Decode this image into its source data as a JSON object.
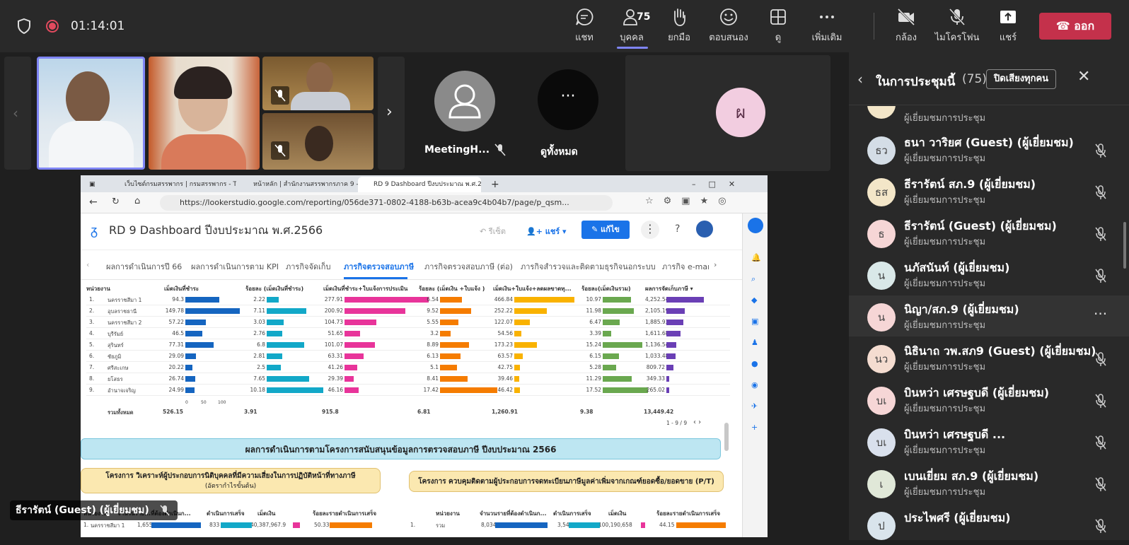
{
  "meeting": {
    "timer": "01:14:01",
    "toolbar": [
      {
        "label": "แชท",
        "icon": "chat-icon"
      },
      {
        "label": "บุคคล",
        "icon": "people-icon",
        "count": "75"
      },
      {
        "label": "ยกมือ",
        "icon": "raise-hand-icon"
      },
      {
        "label": "ตอบสนอง",
        "icon": "react-icon"
      },
      {
        "label": "ดู",
        "icon": "view-icon"
      },
      {
        "label": "เพิ่มเติม",
        "icon": "more-icon"
      },
      {
        "label": "กล้อง",
        "icon": "camera-off-icon"
      },
      {
        "label": "ไมโครโฟน",
        "icon": "mic-off-icon"
      },
      {
        "label": "แชร์",
        "icon": "share-icon"
      }
    ],
    "leave_label": "ออก"
  },
  "stage": {
    "tile_meetingh": "MeetingH...",
    "tile_view_all": "ดูทั้งหมด",
    "tile_initial": "ผ",
    "speaker_caption": "ธีรารัตน์ (Guest) (ผู้เยี่ยมชม)"
  },
  "browser": {
    "tabs": [
      "เว็บไซต์กรมสรรพากร | กรมสรรพากร - Th",
      "หน้าหลัก | สำนักงานสรรพากรภาค 9 -",
      "RD 9 Dashboard ปีงบประมาณ พ.ศ.2"
    ],
    "url": "https://lookerstudio.google.com/reporting/056de371-0802-4188-b63b-acea9c4b04b7/page/p_qsm...",
    "report_title": "RD 9 Dashboard ปีงบประมาณ พ.ศ.2566",
    "reset_label": "รีเซ็ต",
    "share_label": "แชร์",
    "edit_label": "แก้ไข",
    "nav_tabs": [
      "ผลการดำเนินการปี 66",
      "ผลการดำเนินการตาม KPI",
      "ภารกิจจัดเก็บ",
      "ภารกิจตรวจสอบภาษี",
      "ภารกิจตรวจสอบภาษี (ต่อ)",
      "ภารกิจสำรวจและติดตามธุรกิจนอกระบบ",
      "ภารกิจ e-mar"
    ],
    "table": {
      "headers": [
        "หน่วยงาน",
        "เม็ดเงินที่ชำระ",
        "ร้อยละ (เม็ดเงินที่ชำระ)",
        "เม็ดเงินที่ชำระ+ใบแจ้งการประเมิน",
        "ร้อยละ (เม็ดเงิน +ใบแจ้ง )",
        "เม็ดเงิน+ใบแจ้ง+ลดผลขาดทุ...",
        "ร้อยละ(เม็ดเงินรวม)",
        "ผลการจัดเก็บภาษี ▾"
      ],
      "rows": [
        {
          "no": "1.",
          "unit": "นครราชสีมา 1",
          "v": [
            "94.3",
            "2.22",
            "277.91",
            "6.54",
            "466.84",
            "10.97",
            "4,252.54"
          ]
        },
        {
          "no": "2.",
          "unit": "อุบลราชธานี",
          "v": [
            "149.78",
            "7.11",
            "200.92",
            "9.52",
            "252.22",
            "11.98",
            "2,105.19"
          ]
        },
        {
          "no": "3.",
          "unit": "นครราชสีมา 2",
          "v": [
            "57.22",
            "3.03",
            "104.73",
            "5.55",
            "122.07",
            "6.47",
            "1,885.93"
          ]
        },
        {
          "no": "4.",
          "unit": "บุรีรัมย์",
          "v": [
            "46.5",
            "2.76",
            "51.65",
            "3.2",
            "54.56",
            "3.39",
            "1,611.68"
          ]
        },
        {
          "no": "5.",
          "unit": "สุรินทร์",
          "v": [
            "77.31",
            "6.8",
            "101.07",
            "8.89",
            "173.23",
            "15.24",
            "1,136.54"
          ]
        },
        {
          "no": "6.",
          "unit": "ชัยภูมิ",
          "v": [
            "29.09",
            "2.81",
            "63.31",
            "6.13",
            "63.57",
            "6.15",
            "1,033.48"
          ]
        },
        {
          "no": "7.",
          "unit": "ศรีสะเกษ",
          "v": [
            "20.22",
            "2.5",
            "41.26",
            "5.1",
            "42.75",
            "5.28",
            "809.72"
          ]
        },
        {
          "no": "8.",
          "unit": "ยโสธร",
          "v": [
            "26.74",
            "7.65",
            "29.39",
            "8.41",
            "39.46",
            "11.29",
            "349.33"
          ]
        },
        {
          "no": "9.",
          "unit": "อำนาจเจริญ",
          "v": [
            "24.99",
            "10.18",
            "46.16",
            "17.42",
            "46.42",
            "17.52",
            "265.02"
          ]
        }
      ],
      "axis_ticks": [
        "0",
        "50",
        "100"
      ],
      "total_label": "รวมทั้งหมด",
      "totals": [
        "526.15",
        "3.91",
        "915.8",
        "6.81",
        "1,260.91",
        "9.38",
        "13,449.42"
      ],
      "pager": "1 - 9 / 9"
    },
    "banner": "ผลการดำเนินการตามโครงการสนับสนุนข้อมูลการตรวจสอบภาษี ปีงบประมาณ 2566",
    "project_left": "โครงการ วิเคราะห์ผู้ประกอบการนิติบุคคลที่มีความเสี่ยงในการปฏิบัติหน้าที่ทางภาษี",
    "project_left_sub": "(อัตรากำไรขั้นต้น)",
    "project_right": "โครงการ ควบคุมติดตามผู้ประกอบการจดทะเบียนภาษีมูลค่าเพิ่มจากเกณฑ์ยอดซื้อ/ยอดขาย (P/T)",
    "bottom_left": {
      "headers": [
        "หน่วยงาน",
        "จำนวนราย...ที่ต้องดำเนินก...",
        "ดำเนินการเสร็จ",
        "เม็ดเงิน",
        "ร้อยละรายดำเนินการเสร็จ"
      ],
      "row": [
        "1.",
        "นครราชสีมา 1",
        "1,655",
        "833",
        "40,387,967.9",
        "50.33"
      ]
    },
    "bottom_right": {
      "headers": [
        "หน่วยงาน",
        "จำนวนรายที่ต้องดำเนินก...",
        "ดำเนินการเสร็จ",
        "เม็ดเงิน",
        "ร้อยละรายดำเนินการเสร็จ"
      ],
      "row": [
        "1.",
        "รวม",
        "8,034",
        "3,547",
        "100,190,658",
        "44.15"
      ]
    }
  },
  "panel": {
    "title": "ในการประชุมนี้",
    "count": "(75)",
    "mute_all": "ปิดเสียงทุกคน",
    "partial_role": "ผู้เยี่ยมชมการประชุม",
    "participants": [
      {
        "initials": "ธว",
        "name": "ธนา วาริยศ (Guest) (ผู้เยี่ยมชม)",
        "role": "ผู้เยี่ยมชมการประชุม",
        "color": "#d4dde6"
      },
      {
        "initials": "ธส",
        "name": "ธีรารัตน์ สภ.9 (ผู้เยี่ยมชม)",
        "role": "ผู้เยี่ยมชมการประชุม",
        "color": "#f3e6c8"
      },
      {
        "initials": "ธ",
        "name": "ธีรารัตน์ (Guest) (ผู้เยี่ยมชม)",
        "role": "ผู้เยี่ยมชมการประชุม",
        "color": "#f6d6d6"
      },
      {
        "initials": "น",
        "name": "นภัสนันท์ (ผู้เยี่ยมชม)",
        "role": "ผู้เยี่ยมชมการประชุม",
        "color": "#d9e8e8"
      },
      {
        "initials": "น",
        "name": "นิญา/สภ.9 (ผู้เยี่ยมชม)",
        "role": "ผู้เยี่ยมชมการประชุม",
        "color": "#f6d6d6"
      },
      {
        "initials": "นว",
        "name": "นิธินาถ วพ.สภ9 (Guest) (ผู้เยี่ยมชม)",
        "role": "ผู้เยี่ยมชมการประชุม",
        "color": "#f4dcd0"
      },
      {
        "initials": "บเ",
        "name": "บินหว่า เศรษฐบดี (ผู้เยี่ยมชม)",
        "role": "ผู้เยี่ยมชมการประชุม",
        "color": "#f6d6d6"
      },
      {
        "initials": "บเ",
        "name": "บินหว่า เศรษฐบดี ...",
        "role": "ผู้เยี่ยมชมการประชุม",
        "color": "#d9e0ec"
      },
      {
        "initials": "เ",
        "name": "เบนเยี่ยม สภ.9 (ผู้เยี่ยมชม)",
        "role": "ผู้เยี่ยมชมการประชุม",
        "color": "#e0e8d8"
      },
      {
        "initials": "ป",
        "name": "ประไพศรี (ผู้เยี่ยมชม)",
        "role": "",
        "color": "#d9e4ec"
      }
    ]
  },
  "colors": {
    "accent": "#7f85f5",
    "leave": "#c4314b",
    "bar_blue": "#1565c0",
    "bar_cyan": "#12a8c8",
    "bar_pink": "#e8349a",
    "bar_orange": "#f57c00",
    "bar_yellow": "#f9b200",
    "bar_green": "#6aa84f",
    "bar_purple": "#6a3fb5"
  }
}
